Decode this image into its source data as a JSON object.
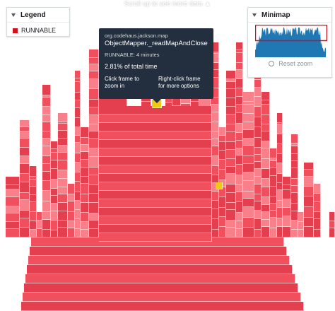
{
  "scroll_hint": "Scroll up to see more data",
  "scroll_icon": "triangle-up-icon",
  "legend": {
    "title": "Legend",
    "items": [
      {
        "label": "RUNNABLE",
        "color": "#d0111b"
      }
    ]
  },
  "minimap": {
    "title": "Minimap",
    "reset_label": "Reset zoom",
    "series_color": "#1f77b4",
    "viewport_color": "#d0111b"
  },
  "tooltip": {
    "package": "org.codehaus.jackson.map",
    "method": "ObjectMapper._readMapAndClose",
    "state": "RUNNABLE: 4 minutes",
    "percent": "2.81% of total time",
    "hint_left": "Click frame to zoom in",
    "hint_right": "Right-click frame for more options"
  },
  "colors": {
    "frame": "#f0505e",
    "frame_dark": "#e33f4f",
    "frame_light": "#f7808a",
    "highlight": "#f2c811",
    "tooltip_bg": "#232f3e"
  }
}
